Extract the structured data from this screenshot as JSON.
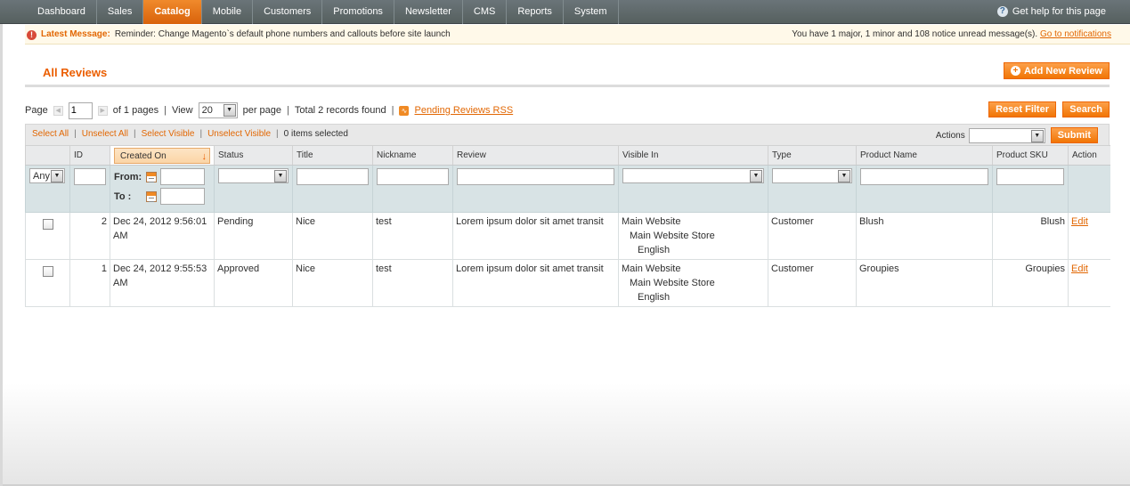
{
  "nav": {
    "items": [
      "Dashboard",
      "Sales",
      "Catalog",
      "Mobile",
      "Customers",
      "Promotions",
      "Newsletter",
      "CMS",
      "Reports",
      "System"
    ],
    "active": "Catalog",
    "help": "Get help for this page"
  },
  "message": {
    "label": "Latest Message:",
    "text": "Reminder: Change Magento`s default phone numbers and callouts before site launch",
    "summary": "You have 1 major, 1 minor and 108 notice unread message(s).",
    "link": "Go to notifications"
  },
  "page": {
    "title": "All Reviews",
    "add_button": "Add New Review"
  },
  "pager": {
    "page_label": "Page",
    "current_page": "1",
    "of_pages": "of 1 pages",
    "view_label": "View",
    "per_page_value": "20",
    "per_page_label": "per page",
    "records": "Total 2 records found",
    "rss_link": "Pending Reviews RSS",
    "reset_button": "Reset Filter",
    "search_button": "Search"
  },
  "massaction": {
    "select_all": "Select All",
    "unselect_all": "Unselect All",
    "select_visible": "Select Visible",
    "unselect_visible": "Unselect Visible",
    "selected": "0 items selected",
    "actions_label": "Actions",
    "submit": "Submit"
  },
  "table": {
    "columns": [
      "",
      "ID",
      "Created On",
      "Status",
      "Title",
      "Nickname",
      "Review",
      "Visible In",
      "Type",
      "Product Name",
      "Product SKU",
      "Action"
    ],
    "filter": {
      "any": "Any",
      "from": "From:",
      "to": "To :"
    },
    "rows": [
      {
        "id": "2",
        "created_line1": "Dec 24, 2012 9:56:01",
        "created_line2": "AM",
        "status": "Pending",
        "title": "Nice",
        "nickname": "test",
        "review": "Lorem ipsum dolor sit amet transit",
        "visible_1": "Main Website",
        "visible_2": "Main Website Store",
        "visible_3": "English",
        "type": "Customer",
        "product_name": "Blush",
        "sku": "Blush",
        "action": "Edit"
      },
      {
        "id": "1",
        "created_line1": "Dec 24, 2012 9:55:53",
        "created_line2": "AM",
        "status": "Approved",
        "title": "Nice",
        "nickname": "test",
        "review": "Lorem ipsum dolor sit amet transit",
        "visible_1": "Main Website",
        "visible_2": "Main Website Store",
        "visible_3": "English",
        "type": "Customer",
        "product_name": "Groupies",
        "sku": "Groupies",
        "action": "Edit"
      }
    ]
  },
  "colors": {
    "accent": "#eb5e00",
    "nav_bg": "#6a7479",
    "button": "#f17505",
    "filter_bg": "#d8e3e5"
  }
}
